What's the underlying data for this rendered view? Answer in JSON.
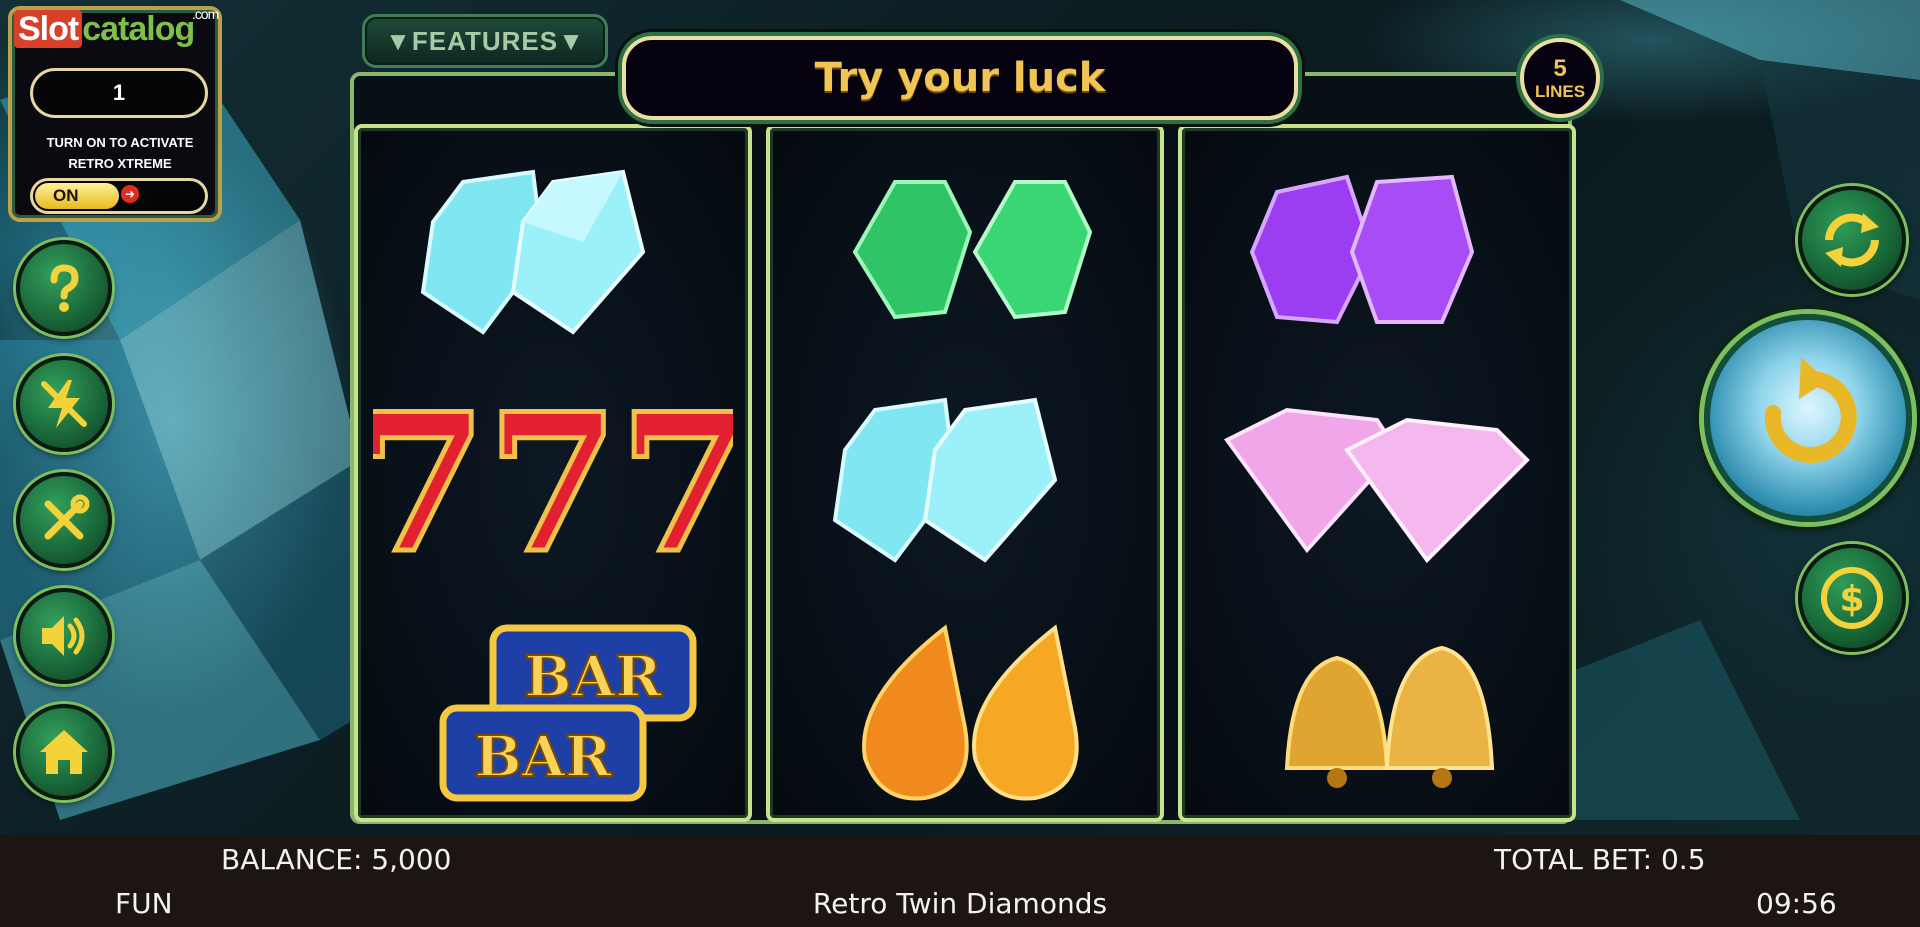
{
  "watermark": {
    "part1": "Slot",
    "part2": "catalog",
    "suffix": ".com"
  },
  "xtreme_panel": {
    "value": "1",
    "description_line1": "TURN ON TO ACTIVATE",
    "description_line2": "RETRO XTREME",
    "toggle_label": "ON",
    "toggle_state": "on"
  },
  "side_buttons": [
    {
      "name": "help",
      "icon": "question-icon"
    },
    {
      "name": "turbo",
      "icon": "lightning-off-icon"
    },
    {
      "name": "settings",
      "icon": "tools-icon"
    },
    {
      "name": "sound",
      "icon": "speaker-icon"
    },
    {
      "name": "home",
      "icon": "home-icon"
    }
  ],
  "features_button": {
    "label": "▼FEATURES▼"
  },
  "banner": {
    "message": "Try your luck"
  },
  "lines_badge": {
    "count": "5",
    "label": "LINES"
  },
  "reels": [
    {
      "symbols": [
        "blue-gem-double",
        "triple-seven",
        "double-bar"
      ]
    },
    {
      "symbols": [
        "green-gem-double",
        "blue-gem-double",
        "orange-drop-gem-double"
      ]
    },
    {
      "symbols": [
        "purple-gem-double",
        "pink-diamond-double",
        "bell-double"
      ]
    }
  ],
  "bar_symbol_text": "BAR",
  "right_buttons": {
    "autoplay": "autoplay-icon",
    "spin": "spin-icon",
    "bet": "coin-dollar-icon"
  },
  "colors": {
    "accent_gold": "#f0c553",
    "frame_green": "#8ab66e",
    "status_bar": "#1c1512"
  },
  "status_bar": {
    "balance": "BALANCE: 5,000",
    "total_bet": "TOTAL BET: 0.5",
    "mode": "FUN",
    "game_title": "Retro Twin Diamonds",
    "clock": "09:56"
  }
}
